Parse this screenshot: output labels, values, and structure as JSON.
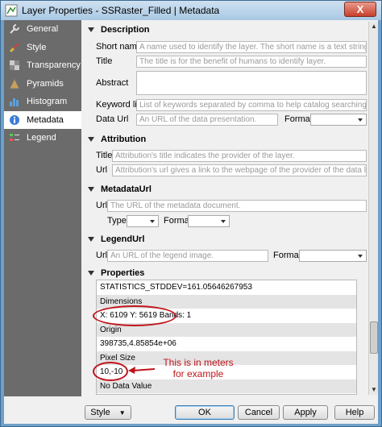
{
  "window": {
    "title": "Layer Properties - SSRaster_Filled | Metadata",
    "close_label": "X"
  },
  "sidebar": {
    "items": [
      {
        "label": "General",
        "icon": "wrench-icon",
        "active": false
      },
      {
        "label": "Style",
        "icon": "brush-icon",
        "active": false
      },
      {
        "label": "Transparency",
        "icon": "transparency-icon",
        "active": false
      },
      {
        "label": "Pyramids",
        "icon": "pyramid-icon",
        "active": false
      },
      {
        "label": "Histogram",
        "icon": "histogram-icon",
        "active": false
      },
      {
        "label": "Metadata",
        "icon": "info-icon",
        "active": true
      },
      {
        "label": "Legend",
        "icon": "legend-icon",
        "active": false
      }
    ]
  },
  "description": {
    "header": "Description",
    "short_name_label": "Short name",
    "short_name_placeholder": "A name used to identify the layer. The short name is a text string used for m...",
    "title_label": "Title",
    "title_placeholder": "The title is for the benefit of humans to identify layer.",
    "abstract_label": "Abstract",
    "keyword_label": "Keyword list",
    "keyword_placeholder": "List of keywords separated by comma to help catalog searching.",
    "dataurl_label": "Data Url",
    "dataurl_placeholder": "An URL of the data presentation.",
    "format_label": "Format"
  },
  "attribution": {
    "header": "Attribution",
    "title_label": "Title",
    "title_placeholder": "Attribution's title indicates the provider of the layer.",
    "url_label": "Url",
    "url_placeholder": "Attribution's url gives a link to the webpage of the provider of the data layer."
  },
  "metadataurl": {
    "header": "MetadataUrl",
    "url_label": "Url",
    "url_placeholder": "The URL of the metadata document.",
    "type_label": "Type",
    "format_label": "Format"
  },
  "legendurl": {
    "header": "LegendUrl",
    "url_label": "Url",
    "url_placeholder": "An URL of the legend image.",
    "format_label": "Format"
  },
  "properties": {
    "header": "Properties",
    "rows": [
      {
        "text": "STATISTICS_STDDEV=161.05646267953",
        "header": false
      },
      {
        "text": "Dimensions",
        "header": true
      },
      {
        "text": "X: 6109 Y: 5619 Bands: 1",
        "header": false
      },
      {
        "text": "Origin",
        "header": true
      },
      {
        "text": "398735,4.85854e+06",
        "header": false
      },
      {
        "text": "Pixel Size",
        "header": true
      },
      {
        "text": "10,-10",
        "header": false
      },
      {
        "text": "No Data Value",
        "header": true
      }
    ],
    "annotation": "This is in meters\nfor example"
  },
  "buttons": {
    "style": "Style",
    "ok": "OK",
    "cancel": "Cancel",
    "apply": "Apply",
    "help": "Help"
  },
  "colors": {
    "annotation": "#c0141c",
    "sidebar_bg": "#6b6b6b"
  }
}
